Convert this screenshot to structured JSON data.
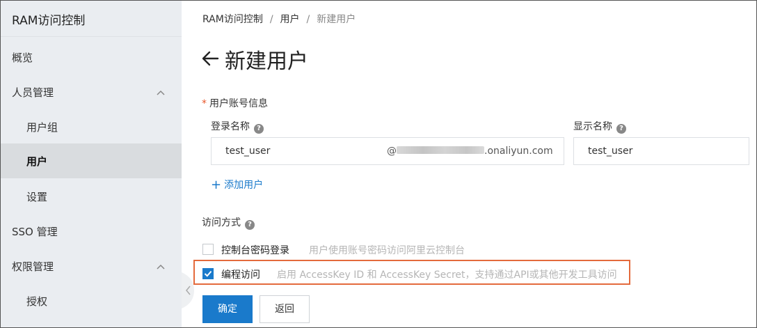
{
  "sidebar": {
    "title": "RAM访问控制",
    "items": [
      {
        "label": "概览"
      },
      {
        "label": "人员管理"
      },
      {
        "label": "用户组"
      },
      {
        "label": "用户"
      },
      {
        "label": "设置"
      },
      {
        "label": "SSO 管理"
      },
      {
        "label": "权限管理"
      },
      {
        "label": "授权"
      }
    ]
  },
  "breadcrumb": [
    "RAM访问控制",
    "用户",
    "新建用户"
  ],
  "breadcrumb_sep": "/",
  "page_title": "新建用户",
  "account_section": {
    "label": "用户账号信息",
    "login_name_label": "登录名称",
    "display_name_label": "显示名称",
    "login_name_value": "test_user",
    "domain_prefix": "@",
    "domain_suffix": ".onaliyun.com",
    "display_name_value": "test_user",
    "add_user_label": "添加用户"
  },
  "access_section": {
    "label": "访问方式",
    "options": [
      {
        "label": "控制台密码登录",
        "description": "用户使用账号密码访问阿里云控制台",
        "checked": false
      },
      {
        "label": "编程访问",
        "description": "启用 AccessKey ID 和 AccessKey Secret，支持通过API或其他开发工具访问",
        "checked": true
      }
    ]
  },
  "buttons": {
    "confirm": "确定",
    "back": "返回"
  },
  "colors": {
    "accent": "#1a7acb",
    "highlight": "#e46a3c",
    "sidebar_bg": "#eaedf1"
  }
}
